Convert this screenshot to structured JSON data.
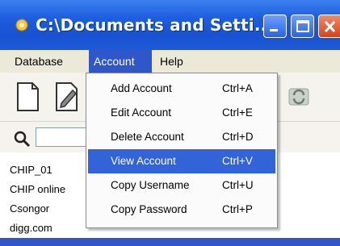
{
  "window": {
    "title": "C:\\Documents and Setti..."
  },
  "menubar": {
    "items": [
      {
        "label": "Database"
      },
      {
        "label": "Account"
      },
      {
        "label": "Help"
      }
    ]
  },
  "account_menu": {
    "items": [
      {
        "label": "Add Account",
        "shortcut": "Ctrl+A"
      },
      {
        "label": "Edit Account",
        "shortcut": "Ctrl+E"
      },
      {
        "label": "Delete Account",
        "shortcut": "Ctrl+D"
      },
      {
        "label": "View Account",
        "shortcut": "Ctrl+V",
        "selected": true
      },
      {
        "label": "Copy Username",
        "shortcut": "Ctrl+U"
      },
      {
        "label": "Copy Password",
        "shortcut": "Ctrl+P"
      }
    ]
  },
  "search": {
    "value": ""
  },
  "accounts": {
    "items": [
      {
        "label": "CHIP_01"
      },
      {
        "label": "CHIP online"
      },
      {
        "label": "Csongor"
      },
      {
        "label": "digg.com"
      }
    ]
  },
  "colors": {
    "titlebar": "#1f5ee0",
    "menu_highlight": "#2f57c9",
    "selected_item": "#3263d8"
  }
}
